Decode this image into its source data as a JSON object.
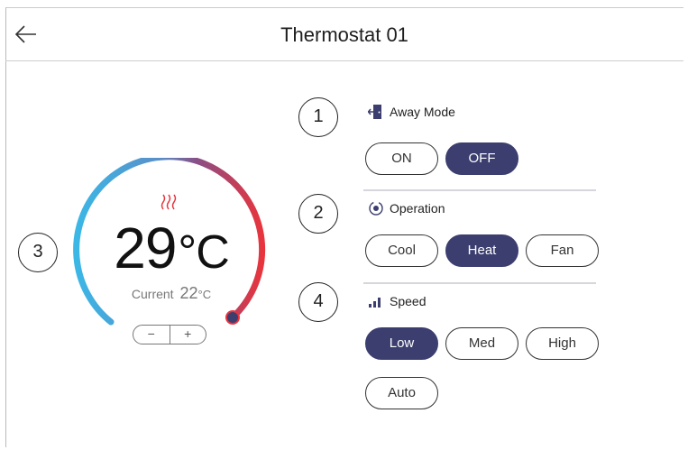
{
  "header": {
    "title": "Thermostat 01",
    "back_icon": "arrow-left-icon"
  },
  "callouts": {
    "c1": "1",
    "c2": "2",
    "c3": "3",
    "c4": "4"
  },
  "dial": {
    "setpoint_value": "29",
    "setpoint_unit": "°C",
    "current_label": "Current",
    "current_value": "22",
    "current_unit": "°C",
    "minus_label": "−",
    "plus_label": "+",
    "arc_colors": [
      "#3bb7e6",
      "#8a4f86",
      "#e8343d"
    ],
    "mode_icon": "heat-waves-icon"
  },
  "away_mode": {
    "label": "Away Mode",
    "icon": "door-exit-icon",
    "options": [
      "ON",
      "OFF"
    ],
    "selected": "OFF"
  },
  "operation": {
    "label": "Operation",
    "icon": "radio-target-icon",
    "options": [
      "Cool",
      "Heat",
      "Fan"
    ],
    "selected": "Heat"
  },
  "speed": {
    "label": "Speed",
    "icon": "signal-bars-icon",
    "options": [
      "Low",
      "Med",
      "High",
      "Auto"
    ],
    "selected": "Low"
  },
  "colors": {
    "accent": "#3b3e6f",
    "heat": "#e8343d",
    "cool": "#3bb7e6"
  }
}
